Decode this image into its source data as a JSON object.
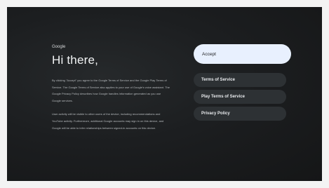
{
  "brand": "Google",
  "heading": "Hi there,",
  "paragraphs": [
    "By clicking \"Accept\" you agree to the Google Terms of Service and the Google Play Terms of Service. The Google Terms of Service also applies to your use of Google's voice assistant. The Google Privacy Policy describes how Google handles information generated as you use Google services.",
    "User activity will be visible to other users of the device, including recommendations and YouTube activity. Furthermore, additional Google accounts may sign in on this device, and Google will be able to infer relationships between signed-in accounts on this device."
  ],
  "buttons": {
    "accept": "Accept",
    "terms": "Terms of Service",
    "play_terms": "Play Terms of Service",
    "privacy": "Privacy Policy"
  }
}
